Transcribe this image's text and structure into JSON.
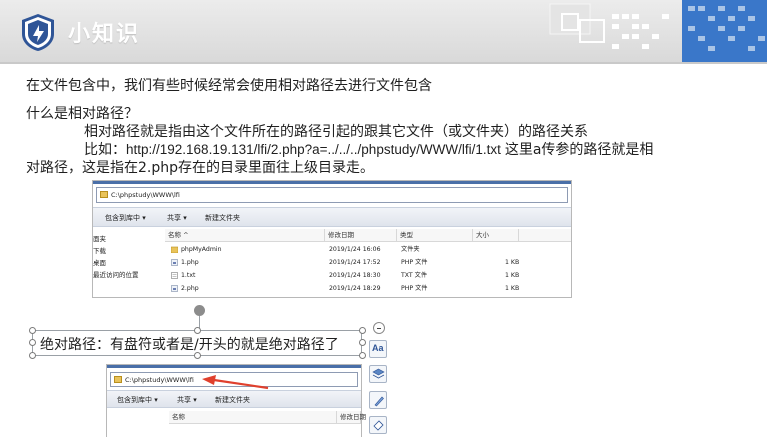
{
  "header": {
    "title": "小知识",
    "logo_icon": "shield-logo-icon"
  },
  "body": {
    "line1": "在文件包含中，我们有些时候经常会使用相对路径去进行文件包含",
    "line2": "什么是相对路径？",
    "line3": "相对路径就是指由这个文件所在的路径引起的跟其它文件（或文件夹）的路径关系",
    "line4_prefix": "比如：",
    "line4_url": "http://192.168.19.131/lfi/2.php?a=../../../phpstudy/WWW/lfi/1.txt",
    "line4_suffix": "这里a传参的路径就是相",
    "line5": "对路径，这是指在2.php存在的目录里面往上级目录走。",
    "absolute_text": "绝对路径：有盘符或者是/开头的就是绝对路径了"
  },
  "explorer1": {
    "address": "C:\\phpstudy\\WWW\\lfi",
    "toolbar": {
      "include": "包含到库中",
      "share": "共享",
      "new_folder": "新建文件夹"
    },
    "columns": [
      "名称",
      "修改日期",
      "类型",
      "大小"
    ],
    "nav_items": [
      "面夹",
      "下载",
      "桌面",
      "最近访问的位置"
    ],
    "files": [
      {
        "name": "phpMyAdmin",
        "date": "2019/1/24 16:06",
        "type": "文件夹",
        "size": "",
        "icon": "folder-icon"
      },
      {
        "name": "1.php",
        "date": "2019/1/24 17:52",
        "type": "PHP 文件",
        "size": "1 KB",
        "icon": "php-file-icon"
      },
      {
        "name": "1.txt",
        "date": "2019/1/24 18:30",
        "type": "TXT 文件",
        "size": "1 KB",
        "icon": "text-file-icon"
      },
      {
        "name": "2.php",
        "date": "2019/1/24 18:29",
        "type": "PHP 文件",
        "size": "1 KB",
        "icon": "php-file-icon"
      }
    ]
  },
  "explorer2": {
    "address": "C:\\phpstudy\\WWW\\lfi",
    "toolbar": {
      "include": "包含到库中",
      "share": "共享",
      "new_folder": "新建文件夹"
    },
    "columns": [
      "名称",
      "修改日期"
    ]
  },
  "side_toolbar": {
    "font_icon_label": "Aa"
  },
  "colors": {
    "header_grad_top": "#ececec",
    "header_grad_bottom": "#d9d9d9",
    "logo_blue": "#2f5597",
    "deco_blue": "#3a77c9",
    "deco_light": "#a9c4e6",
    "arrow_red": "#e0402d",
    "win_blue": "#4a6fa8"
  }
}
